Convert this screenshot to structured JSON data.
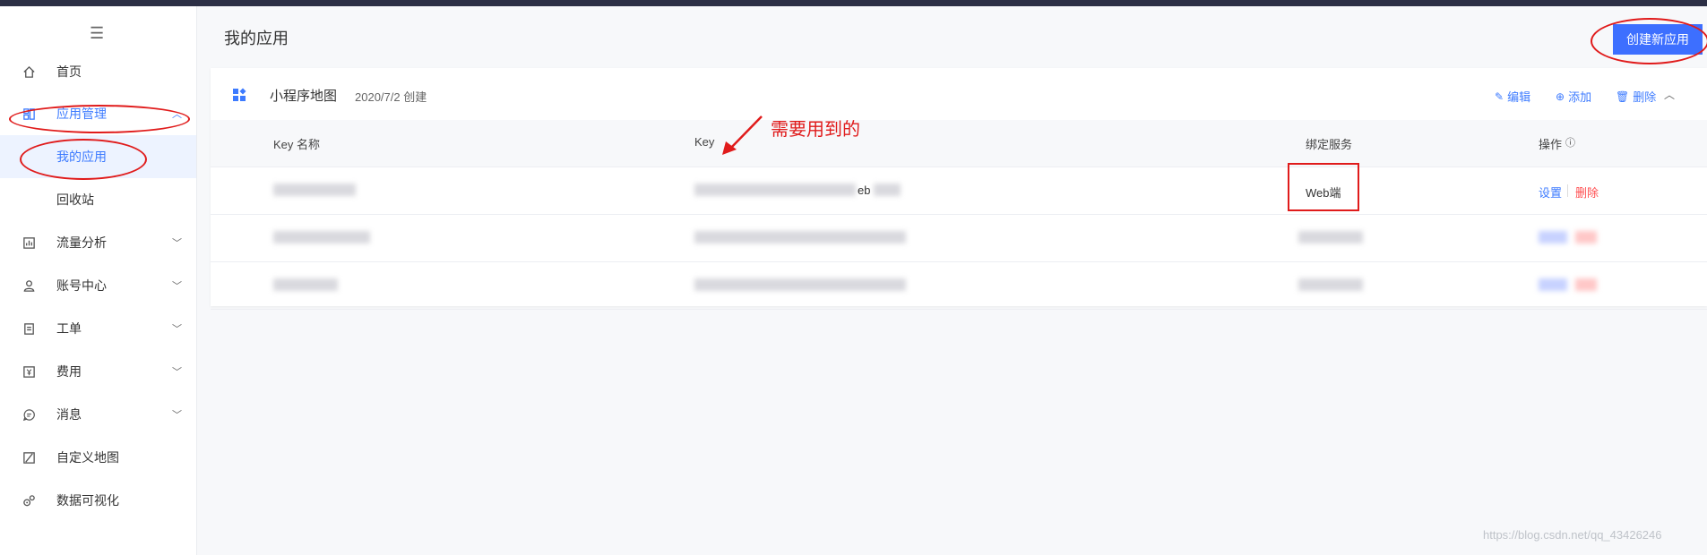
{
  "sidebar": {
    "menu_icon": "hamburger-icon",
    "items": [
      {
        "label": "首页",
        "icon": "home-icon"
      },
      {
        "label": "应用管理",
        "icon": "grid-icon"
      },
      {
        "label": "我的应用"
      },
      {
        "label": "回收站"
      },
      {
        "label": "流量分析",
        "icon": "chart-icon"
      },
      {
        "label": "账号中心",
        "icon": "user-icon"
      },
      {
        "label": "工单",
        "icon": "ticket-icon"
      },
      {
        "label": "费用",
        "icon": "yen-icon"
      },
      {
        "label": "消息",
        "icon": "message-icon"
      },
      {
        "label": "自定义地图",
        "icon": "map-edit-icon"
      },
      {
        "label": "数据可视化",
        "icon": "visualization-icon"
      }
    ]
  },
  "header": {
    "title": "我的应用",
    "create_button": "创建新应用"
  },
  "app_card": {
    "name": "小程序地图",
    "date": "2020/7/2 创建",
    "actions": {
      "edit": "编辑",
      "add": "添加",
      "delete": "删除"
    }
  },
  "table": {
    "columns": [
      "Key 名称",
      "Key",
      "绑定服务",
      "操作"
    ],
    "rows": [
      {
        "key_suffix": "eb",
        "service": "Web端",
        "ops": [
          "设置",
          "删除"
        ]
      }
    ]
  },
  "annotation": "需要用到的",
  "watermark": "https://blog.csdn.net/qq_43426246",
  "colors": {
    "accent": "#3d7bff",
    "danger": "#ff4d4f",
    "annotation": "#e01b1b"
  }
}
